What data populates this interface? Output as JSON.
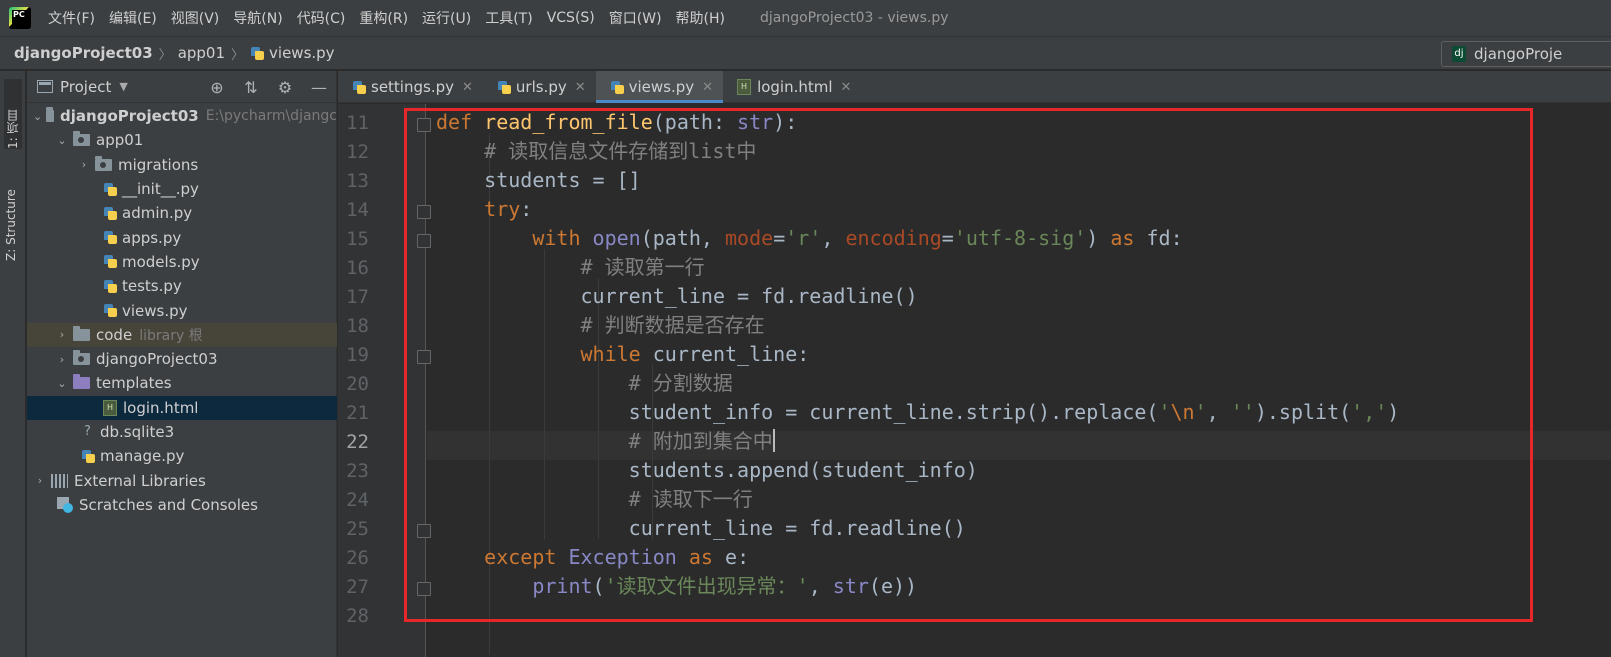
{
  "menubar": {
    "items": [
      "文件(F)",
      "编辑(E)",
      "视图(V)",
      "导航(N)",
      "代码(C)",
      "重构(R)",
      "运行(U)",
      "工具(T)",
      "VCS(S)",
      "窗口(W)",
      "帮助(H)"
    ],
    "window_title": "djangoProject03 - views.py"
  },
  "navbar": {
    "crumbs": [
      "djangoProject03",
      "app01",
      "views.py"
    ],
    "run_config": "djangoProje"
  },
  "left_stripe": {
    "project": "1: 项目",
    "structure": "Z: Structure"
  },
  "project_panel": {
    "title": "Project",
    "tree": [
      {
        "label": "djangoProject03",
        "hint": "E:\\pycharm\\djangc"
      },
      {
        "label": "app01"
      },
      {
        "label": "migrations"
      },
      {
        "label": "__init__.py"
      },
      {
        "label": "admin.py"
      },
      {
        "label": "apps.py"
      },
      {
        "label": "models.py"
      },
      {
        "label": "tests.py"
      },
      {
        "label": "views.py"
      },
      {
        "label": "code",
        "hint": "library 根"
      },
      {
        "label": "djangoProject03"
      },
      {
        "label": "templates"
      },
      {
        "label": "login.html"
      },
      {
        "label": "db.sqlite3"
      },
      {
        "label": "manage.py"
      },
      {
        "label": "External Libraries"
      },
      {
        "label": "Scratches and Consoles"
      }
    ]
  },
  "tabs": [
    "settings.py",
    "urls.py",
    "views.py",
    "login.html"
  ],
  "editor": {
    "line_numbers": [
      "11",
      "12",
      "13",
      "14",
      "15",
      "16",
      "17",
      "18",
      "19",
      "20",
      "21",
      "22",
      "23",
      "24",
      "25",
      "26",
      "27",
      "28"
    ],
    "current_line": "22"
  },
  "colors": {
    "keyword": "#cc7832",
    "function": "#ffc66d",
    "string": "#6a8759",
    "comment": "#808080",
    "highlight_box": "#e8272a"
  }
}
